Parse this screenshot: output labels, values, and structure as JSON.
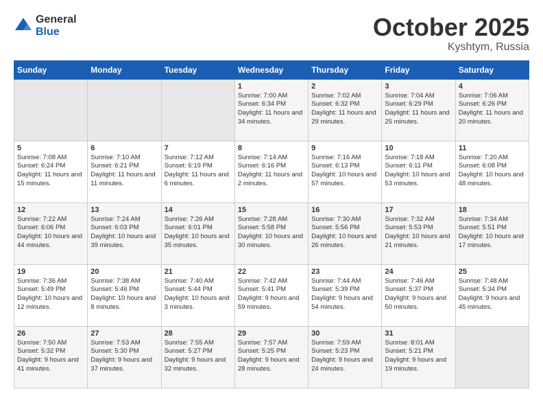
{
  "logo": {
    "general": "General",
    "blue": "Blue"
  },
  "title": "October 2025",
  "location": "Kyshtym, Russia",
  "days_of_week": [
    "Sunday",
    "Monday",
    "Tuesday",
    "Wednesday",
    "Thursday",
    "Friday",
    "Saturday"
  ],
  "rows": [
    [
      {
        "day": "",
        "sunrise": "",
        "sunset": "",
        "daylight": "",
        "empty": true
      },
      {
        "day": "",
        "sunrise": "",
        "sunset": "",
        "daylight": "",
        "empty": true
      },
      {
        "day": "",
        "sunrise": "",
        "sunset": "",
        "daylight": "",
        "empty": true
      },
      {
        "day": "1",
        "sunrise": "Sunrise: 7:00 AM",
        "sunset": "Sunset: 6:34 PM",
        "daylight": "Daylight: 11 hours and 34 minutes."
      },
      {
        "day": "2",
        "sunrise": "Sunrise: 7:02 AM",
        "sunset": "Sunset: 6:32 PM",
        "daylight": "Daylight: 11 hours and 29 minutes."
      },
      {
        "day": "3",
        "sunrise": "Sunrise: 7:04 AM",
        "sunset": "Sunset: 6:29 PM",
        "daylight": "Daylight: 11 hours and 25 minutes."
      },
      {
        "day": "4",
        "sunrise": "Sunrise: 7:06 AM",
        "sunset": "Sunset: 6:26 PM",
        "daylight": "Daylight: 11 hours and 20 minutes."
      }
    ],
    [
      {
        "day": "5",
        "sunrise": "Sunrise: 7:08 AM",
        "sunset": "Sunset: 6:24 PM",
        "daylight": "Daylight: 11 hours and 15 minutes."
      },
      {
        "day": "6",
        "sunrise": "Sunrise: 7:10 AM",
        "sunset": "Sunset: 6:21 PM",
        "daylight": "Daylight: 11 hours and 11 minutes."
      },
      {
        "day": "7",
        "sunrise": "Sunrise: 7:12 AM",
        "sunset": "Sunset: 6:19 PM",
        "daylight": "Daylight: 11 hours and 6 minutes."
      },
      {
        "day": "8",
        "sunrise": "Sunrise: 7:14 AM",
        "sunset": "Sunset: 6:16 PM",
        "daylight": "Daylight: 11 hours and 2 minutes."
      },
      {
        "day": "9",
        "sunrise": "Sunrise: 7:16 AM",
        "sunset": "Sunset: 6:13 PM",
        "daylight": "Daylight: 10 hours and 57 minutes."
      },
      {
        "day": "10",
        "sunrise": "Sunrise: 7:18 AM",
        "sunset": "Sunset: 6:11 PM",
        "daylight": "Daylight: 10 hours and 53 minutes."
      },
      {
        "day": "11",
        "sunrise": "Sunrise: 7:20 AM",
        "sunset": "Sunset: 6:08 PM",
        "daylight": "Daylight: 10 hours and 48 minutes."
      }
    ],
    [
      {
        "day": "12",
        "sunrise": "Sunrise: 7:22 AM",
        "sunset": "Sunset: 6:06 PM",
        "daylight": "Daylight: 10 hours and 44 minutes."
      },
      {
        "day": "13",
        "sunrise": "Sunrise: 7:24 AM",
        "sunset": "Sunset: 6:03 PM",
        "daylight": "Daylight: 10 hours and 39 minutes."
      },
      {
        "day": "14",
        "sunrise": "Sunrise: 7:26 AM",
        "sunset": "Sunset: 6:01 PM",
        "daylight": "Daylight: 10 hours and 35 minutes."
      },
      {
        "day": "15",
        "sunrise": "Sunrise: 7:28 AM",
        "sunset": "Sunset: 5:58 PM",
        "daylight": "Daylight: 10 hours and 30 minutes."
      },
      {
        "day": "16",
        "sunrise": "Sunrise: 7:30 AM",
        "sunset": "Sunset: 5:56 PM",
        "daylight": "Daylight: 10 hours and 26 minutes."
      },
      {
        "day": "17",
        "sunrise": "Sunrise: 7:32 AM",
        "sunset": "Sunset: 5:53 PM",
        "daylight": "Daylight: 10 hours and 21 minutes."
      },
      {
        "day": "18",
        "sunrise": "Sunrise: 7:34 AM",
        "sunset": "Sunset: 5:51 PM",
        "daylight": "Daylight: 10 hours and 17 minutes."
      }
    ],
    [
      {
        "day": "19",
        "sunrise": "Sunrise: 7:36 AM",
        "sunset": "Sunset: 5:49 PM",
        "daylight": "Daylight: 10 hours and 12 minutes."
      },
      {
        "day": "20",
        "sunrise": "Sunrise: 7:38 AM",
        "sunset": "Sunset: 5:46 PM",
        "daylight": "Daylight: 10 hours and 8 minutes."
      },
      {
        "day": "21",
        "sunrise": "Sunrise: 7:40 AM",
        "sunset": "Sunset: 5:44 PM",
        "daylight": "Daylight: 10 hours and 3 minutes."
      },
      {
        "day": "22",
        "sunrise": "Sunrise: 7:42 AM",
        "sunset": "Sunset: 5:41 PM",
        "daylight": "Daylight: 9 hours and 59 minutes."
      },
      {
        "day": "23",
        "sunrise": "Sunrise: 7:44 AM",
        "sunset": "Sunset: 5:39 PM",
        "daylight": "Daylight: 9 hours and 54 minutes."
      },
      {
        "day": "24",
        "sunrise": "Sunrise: 7:46 AM",
        "sunset": "Sunset: 5:37 PM",
        "daylight": "Daylight: 9 hours and 50 minutes."
      },
      {
        "day": "25",
        "sunrise": "Sunrise: 7:48 AM",
        "sunset": "Sunset: 5:34 PM",
        "daylight": "Daylight: 9 hours and 45 minutes."
      }
    ],
    [
      {
        "day": "26",
        "sunrise": "Sunrise: 7:50 AM",
        "sunset": "Sunset: 5:32 PM",
        "daylight": "Daylight: 9 hours and 41 minutes."
      },
      {
        "day": "27",
        "sunrise": "Sunrise: 7:53 AM",
        "sunset": "Sunset: 5:30 PM",
        "daylight": "Daylight: 9 hours and 37 minutes."
      },
      {
        "day": "28",
        "sunrise": "Sunrise: 7:55 AM",
        "sunset": "Sunset: 5:27 PM",
        "daylight": "Daylight: 9 hours and 32 minutes."
      },
      {
        "day": "29",
        "sunrise": "Sunrise: 7:57 AM",
        "sunset": "Sunset: 5:25 PM",
        "daylight": "Daylight: 9 hours and 28 minutes."
      },
      {
        "day": "30",
        "sunrise": "Sunrise: 7:59 AM",
        "sunset": "Sunset: 5:23 PM",
        "daylight": "Daylight: 9 hours and 24 minutes."
      },
      {
        "day": "31",
        "sunrise": "Sunrise: 8:01 AM",
        "sunset": "Sunset: 5:21 PM",
        "daylight": "Daylight: 9 hours and 19 minutes."
      },
      {
        "day": "",
        "sunrise": "",
        "sunset": "",
        "daylight": "",
        "empty": true
      }
    ]
  ]
}
